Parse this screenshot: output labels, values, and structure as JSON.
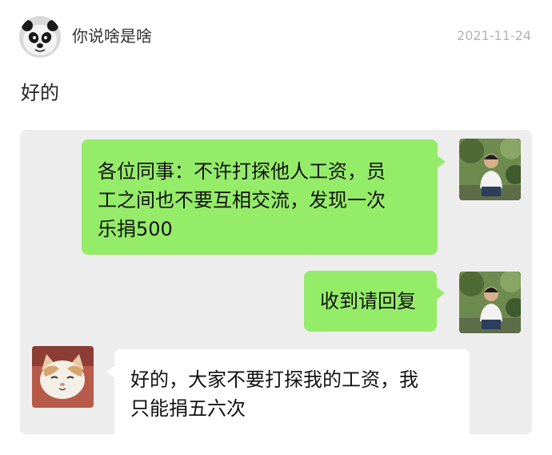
{
  "post": {
    "username": "你说啥是啥",
    "date": "2021-11-24",
    "text": "好的",
    "avatar_icon": "panda-avatar"
  },
  "chat": {
    "messages": [
      {
        "side": "right",
        "bubble_color": "#95ec69",
        "lines": [
          "各位同事：不许打探他人工资，员",
          "工之间也不要互相交流，发现一次",
          "乐捐500"
        ],
        "avatar_icon": "boss-photo-avatar"
      },
      {
        "side": "right",
        "bubble_color": "#95ec69",
        "lines": [
          "收到请回复"
        ],
        "avatar_icon": "boss-photo-avatar"
      },
      {
        "side": "left",
        "bubble_color": "#ffffff",
        "lines": [
          "好的，大家不要打探我的工资，我",
          "只能捐五六次"
        ],
        "avatar_icon": "cat-avatar"
      }
    ]
  }
}
